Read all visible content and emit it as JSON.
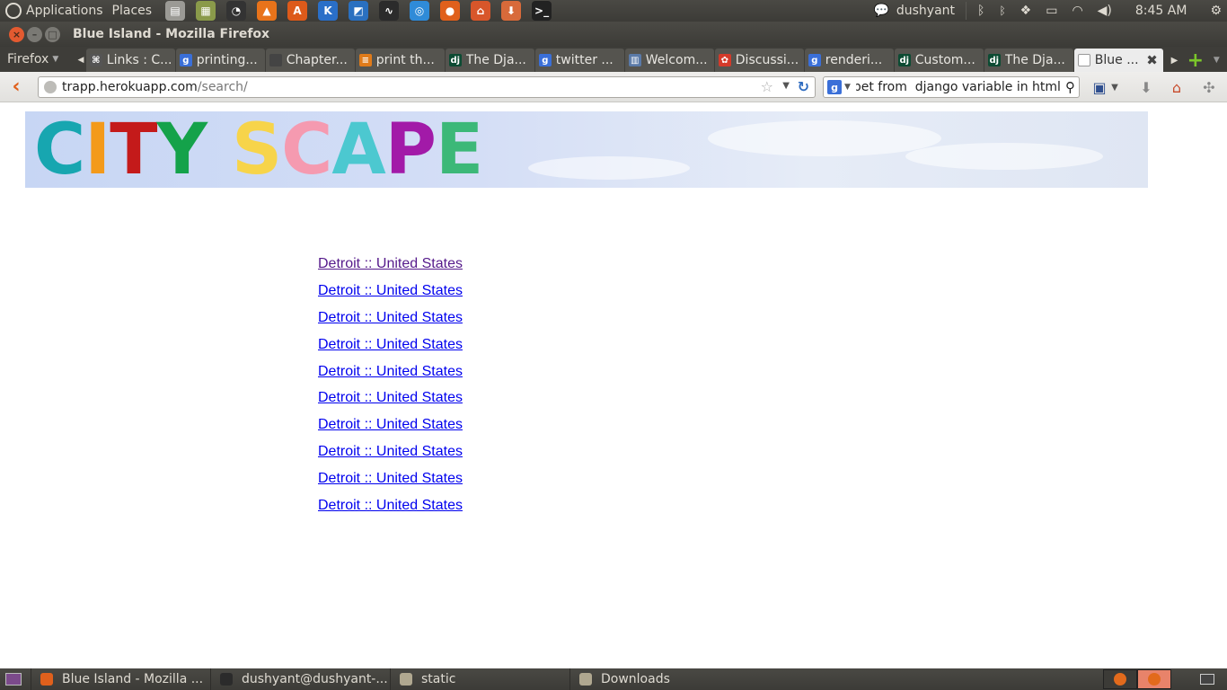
{
  "top_panel": {
    "applications_label": "Applications",
    "places_label": "Places",
    "user": "dushyant",
    "clock": "8:45 AM",
    "launchers": [
      {
        "icon": "trash-launcher-icon",
        "color": "#9b9a95",
        "glyph": "▤"
      },
      {
        "icon": "file-manager-icon",
        "color": "#8a9a4a",
        "glyph": "▦"
      },
      {
        "icon": "clock-app-icon",
        "color": "#333333",
        "glyph": "◔"
      },
      {
        "icon": "vlc-icon",
        "color": "#e8731a",
        "glyph": "▲"
      },
      {
        "icon": "software-center-icon",
        "color": "#dd5a1a",
        "glyph": "A"
      },
      {
        "icon": "kde-icon",
        "color": "#2a6fc8",
        "glyph": "K"
      },
      {
        "icon": "sketch-app-icon",
        "color": "#2a70c0",
        "glyph": "◩"
      },
      {
        "icon": "system-monitor-icon",
        "color": "#2b2b2b",
        "glyph": "∿"
      },
      {
        "icon": "safari-icon",
        "color": "#2f8bd8",
        "glyph": "◎"
      },
      {
        "icon": "firefox-launcher-icon",
        "color": "#e0601c",
        "glyph": "●"
      },
      {
        "icon": "home-folder-icon",
        "color": "#d8562a",
        "glyph": "⌂"
      },
      {
        "icon": "downloads-folder-icon",
        "color": "#d86a3a",
        "glyph": "⬇"
      },
      {
        "icon": "terminal-launcher-icon",
        "color": "#222222",
        "glyph": ">_"
      }
    ]
  },
  "window": {
    "title": "Blue Island - Mozilla Firefox"
  },
  "tabstrip": {
    "menu_label": "Firefox",
    "tabs": [
      {
        "label": "Links : C...",
        "favicon_glyph": "⌘",
        "favicon_color": "#555555"
      },
      {
        "label": "printing...",
        "favicon_glyph": "g",
        "favicon_color": "#3a6fd8"
      },
      {
        "label": "Chapter...",
        "favicon_glyph": "",
        "favicon_color": "#444444"
      },
      {
        "label": "print th...",
        "favicon_glyph": "≡",
        "favicon_color": "#e07b1a"
      },
      {
        "label": "The Dja...",
        "favicon_glyph": "dj",
        "favicon_color": "#0c4b33"
      },
      {
        "label": "twitter ...",
        "favicon_glyph": "g",
        "favicon_color": "#3a6fd8"
      },
      {
        "label": "Welcom...",
        "favicon_glyph": "▥",
        "favicon_color": "#5a7aa8"
      },
      {
        "label": "Discussi...",
        "favicon_glyph": "✿",
        "favicon_color": "#d43a2a"
      },
      {
        "label": "renderi...",
        "favicon_glyph": "g",
        "favicon_color": "#3a6fd8"
      },
      {
        "label": "Custom...",
        "favicon_glyph": "dj",
        "favicon_color": "#0c4b33"
      },
      {
        "label": "The Dja...",
        "favicon_glyph": "dj",
        "favicon_color": "#0c4b33"
      },
      {
        "label": "Blue ...",
        "favicon_glyph": "",
        "favicon_color": "#ffffff",
        "active": true
      }
    ]
  },
  "navbar": {
    "url_host": "trapp.herokuapp.com",
    "url_path": "/search/",
    "search_value": "snippet from  django variable in html"
  },
  "banner": {
    "logo_letters": [
      {
        "char": "C",
        "color": "#17a6b0"
      },
      {
        "char": "I",
        "color": "#f39a1a"
      },
      {
        "char": "T",
        "color": "#c41a1a"
      },
      {
        "char": "Y",
        "color": "#14a24a"
      },
      {
        "char": " ",
        "color": "#ffffff"
      },
      {
        "char": "S",
        "color": "#f7d44a"
      },
      {
        "char": "C",
        "color": "#f59ab0"
      },
      {
        "char": "A",
        "color": "#4cc8d0"
      },
      {
        "char": "P",
        "color": "#a21aa8"
      },
      {
        "char": "E",
        "color": "#3cb878"
      }
    ]
  },
  "results": [
    {
      "text": "Detroit :: United States",
      "visited": true
    },
    {
      "text": "Detroit :: United States",
      "visited": false
    },
    {
      "text": "Detroit :: United States",
      "visited": false
    },
    {
      "text": "Detroit :: United States",
      "visited": false
    },
    {
      "text": "Detroit :: United States",
      "visited": false
    },
    {
      "text": "Detroit :: United States",
      "visited": false
    },
    {
      "text": "Detroit :: United States",
      "visited": false
    },
    {
      "text": "Detroit :: United States",
      "visited": false
    },
    {
      "text": "Detroit :: United States",
      "visited": false
    },
    {
      "text": "Detroit :: United States",
      "visited": false
    }
  ],
  "taskbar": {
    "tasks": [
      {
        "label": "Blue Island - Mozilla ...",
        "icon": "firefox-task-icon",
        "color": "#e0601c"
      },
      {
        "label": "dushyant@dushyant-...",
        "icon": "terminal-task-icon",
        "color": "#2b2b2b"
      },
      {
        "label": "static",
        "icon": "folder-task-icon",
        "color": "#b0a890"
      },
      {
        "label": "Downloads",
        "icon": "folder-task-icon",
        "color": "#b0a890"
      }
    ]
  }
}
